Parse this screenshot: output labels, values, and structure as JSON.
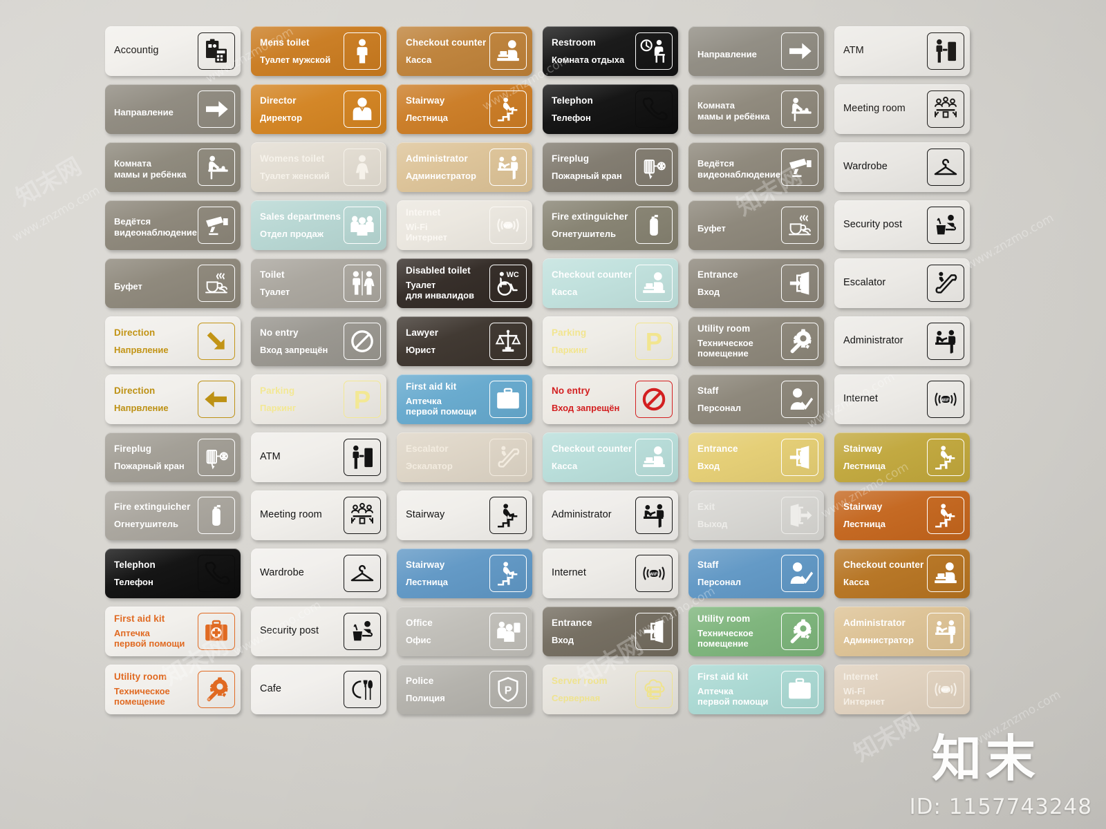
{
  "meta": {
    "id_label": "ID: 1157743248",
    "brand": "知末",
    "watermark_text": "www.znzmo.com",
    "watermark_cn": "知末网",
    "wall_color": "#d8d6d1"
  },
  "plates": [
    {
      "en": "Accountig",
      "ru": "",
      "icon": "clipboard-calculator-icon",
      "bg": "#f2f0ec",
      "fg": "#1e1c1a",
      "icon_border": "#1e1c1a",
      "style": "en"
    },
    {
      "en": "Mens toilet",
      "ru": "Туалет мужской",
      "icon": "man-icon",
      "bg": "#c97a1e",
      "fg": "#ffffff",
      "icon_border": "#ffffff",
      "style": "bi"
    },
    {
      "en": "Checkout counter",
      "ru": "Касса",
      "icon": "cashier-icon",
      "bg": "#bd8037",
      "fg": "#ffffff",
      "icon_border": "#ffffff",
      "style": "bi"
    },
    {
      "en": "Restroom",
      "ru": "Комната отдыха",
      "icon": "clock-rest-icon",
      "bg": "#121212",
      "fg": "#ffffff",
      "icon_border": "#ffffff",
      "style": "bi"
    },
    {
      "en": "",
      "ru": "Направление",
      "icon": "arrow-right-icon",
      "bg": "#8e8a80",
      "fg": "#ffffff",
      "icon_border": "#ffffff",
      "style": "ru"
    },
    {
      "en": "ATM",
      "ru": "",
      "icon": "atm-icon",
      "bg": "#eceae6",
      "fg": "#1e1c1a",
      "icon_border": "#1e1c1a",
      "style": "en"
    },
    {
      "en": "",
      "ru": "Направление",
      "icon": "arrow-right-icon",
      "bg": "#8d887d",
      "fg": "#ffffff",
      "icon_border": "#ffffff",
      "style": "ru"
    },
    {
      "en": "Director",
      "ru": "Директор",
      "icon": "director-icon",
      "bg": "#d2821f",
      "fg": "#ffffff",
      "icon_border": "#ffffff",
      "style": "bi"
    },
    {
      "en": "Stairway",
      "ru": "Лестница",
      "icon": "stairs-up-icon",
      "bg": "#ca7a22",
      "fg": "#ffffff",
      "icon_border": "#ffffff",
      "style": "bi"
    },
    {
      "en": "Telephon",
      "ru": "Телефон",
      "icon": "phone-icon",
      "bg": "#0d0d0d",
      "fg": "#ffffff",
      "icon_border": "#0d0d0d",
      "style": "bi"
    },
    {
      "en": "",
      "ru": "Комната\nмамы и ребёнка",
      "icon": "baby-change-icon",
      "bg": "#8c8679",
      "fg": "#ffffff",
      "icon_border": "#ffffff",
      "style": "ru2"
    },
    {
      "en": "Meeting room",
      "ru": "",
      "icon": "meeting-icon",
      "bg": "#e9e7e3",
      "fg": "#1e1c1a",
      "icon_border": "#1e1c1a",
      "style": "en"
    },
    {
      "en": "",
      "ru": "Комната\nмамы и ребёнка",
      "icon": "baby-change-icon",
      "bg": "#8b8679",
      "fg": "#ffffff",
      "icon_border": "#ffffff",
      "style": "ru2"
    },
    {
      "en": "Womens toilet",
      "ru": "Туалет женский",
      "icon": "woman-icon",
      "bg": "#e2dcd1",
      "fg": "#f6f2ea",
      "icon_border": "#f6f2ea",
      "style": "bi"
    },
    {
      "en": "Administrator",
      "ru": "Администратор",
      "icon": "reception-icon",
      "bg": "#dcc296",
      "fg": "#ffffff",
      "icon_border": "#ffffff",
      "style": "bi"
    },
    {
      "en": "Fireplug",
      "ru": "Пожарный кран",
      "icon": "fire-hose-icon",
      "bg": "#7e786c",
      "fg": "#ffffff",
      "icon_border": "#ffffff",
      "style": "bi"
    },
    {
      "en": "",
      "ru": "Ведётся\nвидеонаблюдение",
      "icon": "cctv-icon",
      "bg": "#8b8578",
      "fg": "#ffffff",
      "icon_border": "#ffffff",
      "style": "ru2"
    },
    {
      "en": "Wardrobe",
      "ru": "",
      "icon": "hanger-icon",
      "bg": "#e8e6e2",
      "fg": "#141414",
      "icon_border": "#141414",
      "style": "en"
    },
    {
      "en": "",
      "ru": "Ведётся\nвидеонаблюдение",
      "icon": "cctv-icon",
      "bg": "#8a8477",
      "fg": "#ffffff",
      "icon_border": "#ffffff",
      "style": "ru2"
    },
    {
      "en": "Sales departmens",
      "ru": "Отдел продаж",
      "icon": "people-group-icon",
      "bg": "#b6d6d2",
      "fg": "#ffffff",
      "icon_border": "#ffffff",
      "style": "bi"
    },
    {
      "en": "Internet",
      "ru": "Wi-Fi\nИнтернет",
      "icon": "wifi-icon",
      "bg": "#ebe7df",
      "fg": "#fbf8f3",
      "icon_border": "#fbf8f3",
      "style": "bi2"
    },
    {
      "en": "Fire extinguicher",
      "ru": "Огнетушитель",
      "icon": "extinguisher-icon",
      "bg": "#84806f",
      "fg": "#ffffff",
      "icon_border": "#ffffff",
      "style": "bi"
    },
    {
      "en": "",
      "ru": "Буфет",
      "icon": "cup-icon",
      "bg": "#8a8477",
      "fg": "#ffffff",
      "icon_border": "#ffffff",
      "style": "ru"
    },
    {
      "en": "Security post",
      "ru": "",
      "icon": "security-desk-icon",
      "bg": "#eceae6",
      "fg": "#141414",
      "icon_border": "#141414",
      "style": "en"
    },
    {
      "en": "",
      "ru": "Буфет",
      "icon": "cup-icon",
      "bg": "#8b8578",
      "fg": "#ffffff",
      "icon_border": "#ffffff",
      "style": "ru"
    },
    {
      "en": "Toilet",
      "ru": "Туалет",
      "icon": "wc-icon",
      "bg": "#a8a49c",
      "fg": "#ffffff",
      "icon_border": "#ffffff",
      "style": "bi"
    },
    {
      "en": "Disabled toilet",
      "ru": "Туалет\nдля инвалидов",
      "icon": "wheelchair-wc-icon",
      "bg": "#2f2722",
      "fg": "#ffffff",
      "icon_border": "#ffffff",
      "style": "bi2"
    },
    {
      "en": "Checkout counter",
      "ru": "Касса",
      "icon": "cashier-icon",
      "bg": "#bfe0dc",
      "fg": "#ffffff",
      "icon_border": "#ffffff",
      "style": "bi"
    },
    {
      "en": "Entrance",
      "ru": "Вход",
      "icon": "door-in-icon",
      "bg": "#8a8478",
      "fg": "#ffffff",
      "icon_border": "#ffffff",
      "style": "bi"
    },
    {
      "en": "Escalator",
      "ru": "",
      "icon": "escalator-icon",
      "bg": "#ebe9e5",
      "fg": "#141414",
      "icon_border": "#141414",
      "style": "en"
    },
    {
      "en": "Direction",
      "ru": "Напрвление",
      "icon": "arrow-downright-icon",
      "bg": "#f1efeb",
      "fg": "#c29415",
      "icon_border": "#c29415",
      "style": "bi"
    },
    {
      "en": "No entry",
      "ru": "Вход запрещён",
      "icon": "no-entry-icon",
      "bg": "#97948d",
      "fg": "#ffffff",
      "icon_border": "#ffffff",
      "style": "bi"
    },
    {
      "en": "Lawyer",
      "ru": "Юрист",
      "icon": "scales-icon",
      "bg": "#3a322b",
      "fg": "#ffffff",
      "icon_border": "#ffffff",
      "style": "bi"
    },
    {
      "en": "Parking",
      "ru": "Паркинг",
      "icon": "parking-p-icon",
      "bg": "#eeece6",
      "fg": "#f2e58f",
      "icon_border": "#f2e58f",
      "style": "bi"
    },
    {
      "en": "Utility room",
      "ru": "Техническое\nпомещение",
      "icon": "gear-wrench-icon",
      "bg": "#8a8477",
      "fg": "#ffffff",
      "icon_border": "#ffffff",
      "style": "bi2"
    },
    {
      "en": "Administrator",
      "ru": "",
      "icon": "reception-icon",
      "bg": "#eceae6",
      "fg": "#141414",
      "icon_border": "#141414",
      "style": "en"
    },
    {
      "en": "Direction",
      "ru": "Напрвление",
      "icon": "arrow-left-icon",
      "bg": "#f1efeb",
      "fg": "#bd9114",
      "icon_border": "#bd9114",
      "style": "bi"
    },
    {
      "en": "Parking",
      "ru": "Паркинг",
      "icon": "parking-p-icon",
      "bg": "#ece9e3",
      "fg": "#f3e894",
      "icon_border": "#f3e894",
      "style": "bi"
    },
    {
      "en": "First aid kit",
      "ru": "Аптечка\nпервой помощи",
      "icon": "first-aid-icon",
      "bg": "#64a8cd",
      "fg": "#ffffff",
      "icon_border": "#ffffff",
      "style": "bi2"
    },
    {
      "en": "No entry",
      "ru": "Вход запрещён",
      "icon": "no-entry-red-icon",
      "bg": "#edeae4",
      "fg": "#d31f20",
      "icon_border": "#d31f20",
      "style": "bi"
    },
    {
      "en": "Staff",
      "ru": "Персонал",
      "icon": "staff-check-icon",
      "bg": "#8a8477",
      "fg": "#ffffff",
      "icon_border": "#ffffff",
      "style": "bi"
    },
    {
      "en": "Internet",
      "ru": "",
      "icon": "wifi-icon",
      "bg": "#eceae6",
      "fg": "#141414",
      "icon_border": "#141414",
      "style": "en"
    },
    {
      "en": "Fireplug",
      "ru": "Пожарный кран",
      "icon": "fire-hose-icon",
      "bg": "#a09c93",
      "fg": "#ffffff",
      "icon_border": "#ffffff",
      "style": "bi"
    },
    {
      "en": "ATM",
      "ru": "",
      "icon": "atm-icon",
      "bg": "#f0eeea",
      "fg": "#141414",
      "icon_border": "#141414",
      "style": "en"
    },
    {
      "en": "Escalator",
      "ru": "Эскалатор",
      "icon": "escalator-icon",
      "bg": "#ddd4c5",
      "fg": "#f3ece0",
      "icon_border": "#f3ece0",
      "style": "bi"
    },
    {
      "en": "Checkout counter",
      "ru": "Касса",
      "icon": "cashier-icon",
      "bg": "#b7ddd9",
      "fg": "#ffffff",
      "icon_border": "#ffffff",
      "style": "bi"
    },
    {
      "en": "Entrance",
      "ru": "Вход",
      "icon": "door-in-icon",
      "bg": "#e4cd72",
      "fg": "#ffffff",
      "icon_border": "#ffffff",
      "style": "bi"
    },
    {
      "en": "Stairway",
      "ru": "Лестница",
      "icon": "stairs-up-icon",
      "bg": "#c0a63a",
      "fg": "#ffffff",
      "icon_border": "#ffffff",
      "style": "bi"
    },
    {
      "en": "Fire extinguicher",
      "ru": "Огнетушитель",
      "icon": "extinguisher-icon",
      "bg": "#a8a49c",
      "fg": "#ffffff",
      "icon_border": "#ffffff",
      "style": "bi"
    },
    {
      "en": "Meeting room",
      "ru": "",
      "icon": "meeting-icon",
      "bg": "#f0eeea",
      "fg": "#141414",
      "icon_border": "#141414",
      "style": "en"
    },
    {
      "en": "Stairway",
      "ru": "",
      "icon": "stairs-up-icon",
      "bg": "#f0eeea",
      "fg": "#141414",
      "icon_border": "#141414",
      "style": "en"
    },
    {
      "en": "Administrator",
      "ru": "",
      "icon": "reception-icon",
      "bg": "#efedea",
      "fg": "#141414",
      "icon_border": "#141414",
      "style": "en"
    },
    {
      "en": "Exit",
      "ru": "Выход",
      "icon": "door-out-icon",
      "bg": "#d6d5d1",
      "fg": "#eeedea",
      "icon_border": "#eeedea",
      "style": "bi"
    },
    {
      "en": "Stairway",
      "ru": "Лестница",
      "icon": "stairs-up-icon",
      "bg": "#c3641b",
      "fg": "#ffffff",
      "icon_border": "#ffffff",
      "style": "bi"
    },
    {
      "en": "Telephon",
      "ru": "Телефон",
      "icon": "phone-icon",
      "bg": "#0c0c0c",
      "fg": "#ffffff",
      "icon_border": "#0c0c0c",
      "style": "bi"
    },
    {
      "en": "Wardrobe",
      "ru": "",
      "icon": "hanger-icon",
      "bg": "#f1efec",
      "fg": "#141414",
      "icon_border": "#141414",
      "style": "en"
    },
    {
      "en": "Stairway",
      "ru": "Лестница",
      "icon": "stairs-up-icon",
      "bg": "#5e96c4",
      "fg": "#ffffff",
      "icon_border": "#ffffff",
      "style": "bi"
    },
    {
      "en": "Internet",
      "ru": "",
      "icon": "wifi-icon",
      "bg": "#edebe7",
      "fg": "#141414",
      "icon_border": "#141414",
      "style": "en"
    },
    {
      "en": "Staff",
      "ru": "Персонал",
      "icon": "staff-check-icon",
      "bg": "#5e96c4",
      "fg": "#ffffff",
      "icon_border": "#ffffff",
      "style": "bi"
    },
    {
      "en": "Checkout counter",
      "ru": "Касса",
      "icon": "cashier-icon",
      "bg": "#b5721f",
      "fg": "#ffffff",
      "icon_border": "#ffffff",
      "style": "bi"
    },
    {
      "en": "First aid kit",
      "ru": "Аптечка\nпервой помощи",
      "icon": "first-aid-icon",
      "bg": "#f1efeb",
      "fg": "#e06a22",
      "icon_border": "#e06a22",
      "style": "bi2"
    },
    {
      "en": "Security post",
      "ru": "",
      "icon": "security-desk-icon",
      "bg": "#f0eeea",
      "fg": "#141414",
      "icon_border": "#141414",
      "style": "en"
    },
    {
      "en": "Office",
      "ru": "Офис",
      "icon": "office-icon",
      "bg": "#bfbdb7",
      "fg": "#ffffff",
      "icon_border": "#ffffff",
      "style": "bi"
    },
    {
      "en": "Entrance",
      "ru": "Вход",
      "icon": "door-in-icon",
      "bg": "#716a5d",
      "fg": "#ffffff",
      "icon_border": "#ffffff",
      "style": "bi"
    },
    {
      "en": "Utility room",
      "ru": "Техническое\nпомещение",
      "icon": "gear-wrench-icon",
      "bg": "#7bb379",
      "fg": "#ffffff",
      "icon_border": "#ffffff",
      "style": "bi2"
    },
    {
      "en": "Administrator",
      "ru": "Администратор",
      "icon": "reception-icon",
      "bg": "#dcc193",
      "fg": "#ffffff",
      "icon_border": "#ffffff",
      "style": "bi"
    },
    {
      "en": "Utility room",
      "ru": "Техническое\nпомещение",
      "icon": "gear-wrench-icon",
      "bg": "#f1efeb",
      "fg": "#e06a22",
      "icon_border": "#e06a22",
      "style": "bi2"
    },
    {
      "en": "Cafe",
      "ru": "",
      "icon": "cafe-icon",
      "bg": "#f1efec",
      "fg": "#141414",
      "icon_border": "#141414",
      "style": "en"
    },
    {
      "en": "Police",
      "ru": "Полиция",
      "icon": "police-shield-icon",
      "bg": "#b2b0aa",
      "fg": "#ffffff",
      "icon_border": "#ffffff",
      "style": "bi"
    },
    {
      "en": "Server room",
      "ru": "Серверная",
      "icon": "server-icon",
      "bg": "#e6e3dc",
      "fg": "#efe38f",
      "icon_border": "#efe38f",
      "style": "bi"
    },
    {
      "en": "First aid kit",
      "ru": "Аптечка\nпервой помощи",
      "icon": "first-aid-icon",
      "bg": "#a9d8d2",
      "fg": "#ffffff",
      "icon_border": "#ffffff",
      "style": "bi2"
    },
    {
      "en": "Internet",
      "ru": "Wi-Fi\nИнтернет",
      "icon": "wifi-icon",
      "bg": "#dfd0bd",
      "fg": "#f5efe6",
      "icon_border": "#f5efe6",
      "style": "bi2"
    }
  ]
}
